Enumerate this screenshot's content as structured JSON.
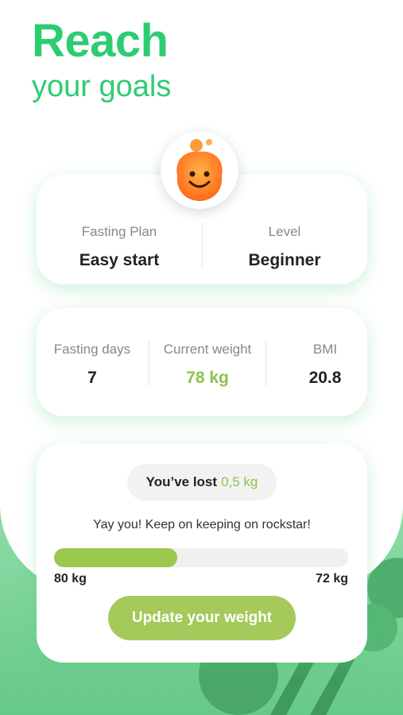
{
  "header": {
    "title": "Reach",
    "subtitle": "your goals"
  },
  "plan_card": {
    "plan_label": "Fasting Plan",
    "plan_value": "Easy start",
    "level_label": "Level",
    "level_value": "Beginner"
  },
  "stats_card": {
    "days_label": "Fasting days",
    "days_value": "7",
    "weight_label": "Current weight",
    "weight_value": "78 kg",
    "bmi_label": "BMI",
    "bmi_value": "20.8"
  },
  "progress_card": {
    "lost_prefix": "You’ve lost",
    "lost_value": "0,5 kg",
    "message": "Yay you! Keep on keeping on rockstar!",
    "start_label": "80 kg",
    "end_label": "72 kg",
    "progress_fraction": 0.42,
    "button_label": "Update your weight"
  },
  "colors": {
    "accent_green": "#2ecc71",
    "lime": "#8ec24a",
    "button": "#a5c95a"
  },
  "icons": {
    "mascot": "smiling-flame-mascot-icon",
    "background": "broccoli-illustration"
  }
}
